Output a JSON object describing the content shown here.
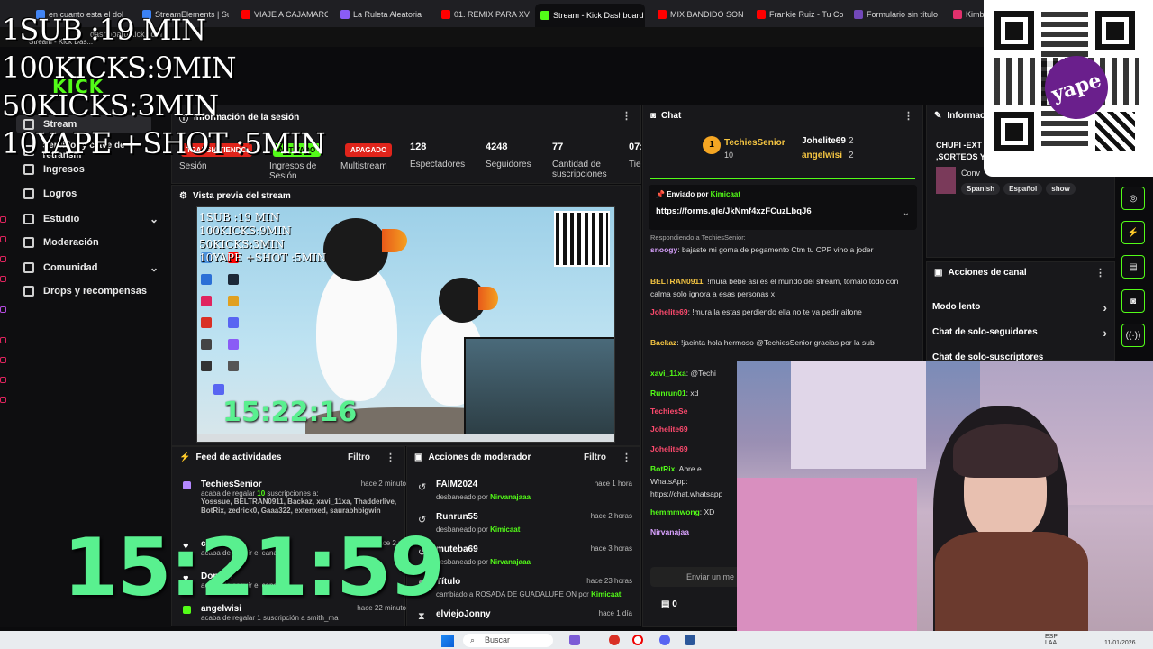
{
  "browser": {
    "tabs": [
      {
        "label": "en cuanto esta el dol",
        "color": "#4285f4"
      },
      {
        "label": "StreamElements | Su",
        "color": "#3b82f6"
      },
      {
        "label": "VIAJE A CAJAMARCA",
        "color": "#ff0000"
      },
      {
        "label": "La Ruleta Aleatoria",
        "color": "#8a5cf6"
      },
      {
        "label": "01. REMIX PARA XV A",
        "color": "#ff0000"
      },
      {
        "label": "Stream - Kick Dashboard",
        "color": "#53fc18"
      },
      {
        "label": "MIX BANDIDO SON D",
        "color": "#ff0000"
      },
      {
        "label": "Frankie Ruiz - Tu Con",
        "color": "#ff0000"
      },
      {
        "label": "Formulario sin título",
        "color": "#7248b9"
      },
      {
        "label": "Kimb",
        "color": "#e1306c"
      }
    ],
    "address": "dashboard.kick.com",
    "sub_tab": "Stream - Kick Das..."
  },
  "kick": {
    "logo": "KICK"
  },
  "sidebar": {
    "items": [
      {
        "label": "Stream",
        "icon": "stream-icon"
      },
      {
        "label": "Servidor y clave de retransm",
        "icon": "key-icon"
      },
      {
        "label": "Ingresos",
        "icon": "money-icon"
      },
      {
        "label": "Logros",
        "icon": "trophy-icon"
      },
      {
        "label": "Estudio",
        "icon": "studio-icon",
        "expandable": true
      },
      {
        "label": "Moderación",
        "icon": "wrench-icon"
      },
      {
        "label": "Comunidad",
        "icon": "community-icon",
        "expandable": true
      },
      {
        "label": "Drops y recompensas",
        "icon": "drops-icon"
      }
    ]
  },
  "session": {
    "title": "Información de la sesión",
    "live_tag": "TRANSMITIENDO",
    "enabled_tag": "ACTIVADO",
    "off_tag": "APAGADO",
    "stats": [
      {
        "value": "",
        "label": "Sesión"
      },
      {
        "value": "",
        "label": "Ingresos de Sesión"
      },
      {
        "value": "",
        "label": "Multistream"
      },
      {
        "value": "128",
        "label": "Espectadores"
      },
      {
        "value": "4248",
        "label": "Seguidores"
      },
      {
        "value": "77",
        "label": "Cantidad de suscripciones"
      },
      {
        "value": "07:",
        "label": "Tie"
      }
    ]
  },
  "preview": {
    "title": "Vista previa del stream",
    "overlay_lines": [
      "1SUB :19 MIN",
      "100KICKS:9MIN",
      "50KICKS:3MIN",
      "10YAPE +SHOT :5MIN"
    ],
    "clock": "15:22:16"
  },
  "activity": {
    "title": "Feed de actividades",
    "filter": "Filtro",
    "rows": [
      {
        "name": "TechiesSenior",
        "time": "hace 2 minutos",
        "text": "acaba de regalar",
        "count": "10",
        "text2": "suscripciones a:",
        "recipients": "Yosssue, BELTRAN0911, Backaz, xavi_11xa, Thadderlive, BotRix, zedrick0, Gaaa322, extenxed, saurabhbigwin"
      },
      {
        "name": "cer0",
        "time": "hace 2 min",
        "text": "acaba de seguir el canal"
      },
      {
        "name": "DonDor",
        "time": "",
        "text": "acaba de seguir el canal"
      },
      {
        "name": "angelwisi",
        "time": "hace 22 minutos",
        "text": "acaba de regalar 1 suscripción a smith_ma"
      }
    ]
  },
  "modactions": {
    "title": "Acciones de moderador",
    "filter": "Filtro",
    "rows": [
      {
        "name": "FAIM2024",
        "time": "hace 1 hora",
        "action": "desbaneado por",
        "by": "Nirvanajaaa",
        "icon": "undo-icon"
      },
      {
        "name": "Runrun55",
        "time": "hace 2 horas",
        "action": "desbaneado por",
        "by": "Kimicaat",
        "icon": "undo-icon"
      },
      {
        "name": "muteba69",
        "time": "hace 3 horas",
        "action": "desbaneado por",
        "by": "Nirvanajaaa",
        "icon": "undo-icon"
      },
      {
        "name": "Título",
        "time": "hace 23 horas",
        "action": "cambiado a ROSADA DE GUADALUPE ON por",
        "by": "Kimicaat",
        "icon": "edit-icon"
      },
      {
        "name": "elviejoJonny",
        "time": "hace 1 día",
        "action": "",
        "by": "",
        "icon": "hourglass-icon"
      }
    ]
  },
  "chat": {
    "title": "Chat",
    "top_gifters": [
      {
        "rank": "1",
        "name": "TechiesSenior",
        "count": "10"
      },
      {
        "name": "Johelite69",
        "count": "2"
      },
      {
        "name": "angelwisi",
        "count": "2"
      }
    ],
    "pinned_label": "Enviado por",
    "pinned_user": "Kimicaat",
    "pinned_link": "https://forms.gle/JkNmf4xzFCuzLbqJ6",
    "reply_to": "Respondiendo a TechiesSenior:",
    "messages": [
      {
        "user": "snoogy",
        "color": "#d9a2ff",
        "text": "bajaste mi goma de pegamento Ctm tu CPP vino a joder"
      },
      {
        "user": "BELTRAN0911",
        "color": "#f5c542",
        "text": "!mura bebe asi es el mundo del stream, tomalo todo con calma solo ignora a esas personas x"
      },
      {
        "user": "Johelite69",
        "color": "#ff4a6e",
        "text": "!mura la estas perdiendo ella no te va pedir aifone"
      },
      {
        "user": "Backaz",
        "color": "#f5c542",
        "text": "!jacinta hola hermoso @TechiesSenior gracias por la sub"
      },
      {
        "user": "xavi_11xa",
        "color": "#53fc18",
        "text": "@Techi"
      },
      {
        "user": "Runrun01",
        "color": "#53fc18",
        "text": "xd"
      },
      {
        "user": "TechiesSe",
        "color": "#ff4a6e",
        "text": ""
      },
      {
        "user": "Johelite69",
        "color": "#ff4a6e",
        "text": ""
      },
      {
        "user": "Johelite69",
        "color": "#ff4a6e",
        "text": ""
      },
      {
        "user": "BotRix",
        "color": "#53fc18",
        "text": "Abre e WhatsApp: https://chat.whatsapp"
      },
      {
        "user": "hemmmwong",
        "color": "#53fc18",
        "text": "XD"
      },
      {
        "user": "Nirvanajaa",
        "color": "#d9a2ff",
        "text": ""
      }
    ],
    "input_placeholder": "Enviar un me",
    "viewer_count": "0"
  },
  "info": {
    "title": "Informaci",
    "stream_title": "CHUPI -EXT ,SORTEOS Y",
    "category": "Conv",
    "tags": [
      "Spanish",
      "Español",
      "show"
    ]
  },
  "channel_actions": {
    "title": "Acciones de canal",
    "rows": [
      "Modo lento",
      "Chat de solo-seguidores",
      "Chat de solo-suscriptores"
    ]
  },
  "overlay": {
    "lines": [
      "1SUB :19 MIN",
      "100KICKS:9MIN",
      "50KICKS:3MIN",
      "10YAPE +SHOT :5MIN"
    ],
    "clock": "15:21:59",
    "yape_logo": "yape"
  },
  "taskbar": {
    "search": "Buscar",
    "lang": "ESP LAA",
    "date": "11/01/2026"
  }
}
